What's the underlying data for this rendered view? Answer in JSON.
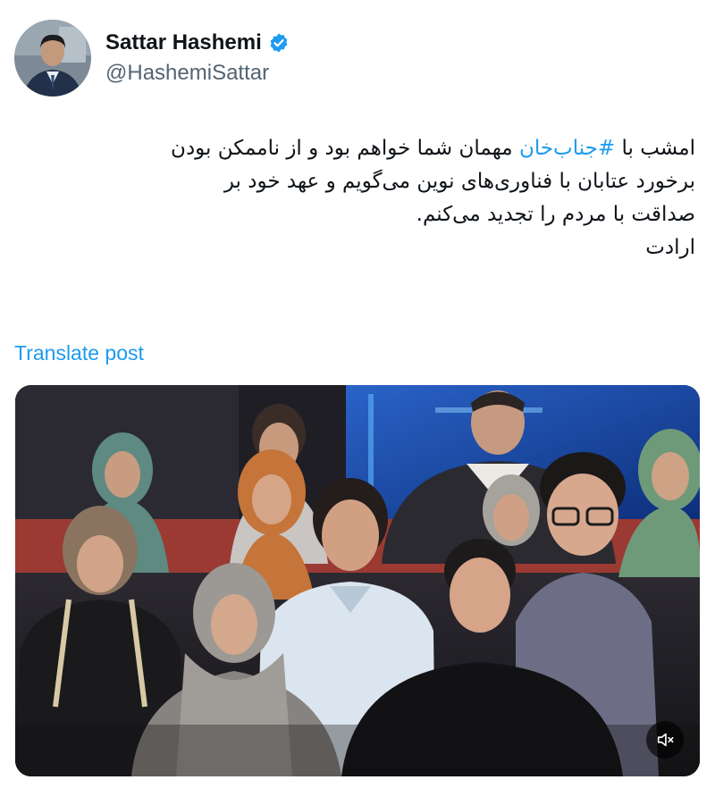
{
  "author": {
    "display_name": "Sattar Hashemi",
    "handle": "@HashemiSattar",
    "verified": true,
    "avatar_icon": "profile-photo"
  },
  "tweet": {
    "line1_prefix": "امشب با ",
    "hashtag": "#جناب‌خان",
    "line1_suffix": " مهمان شما خواهم بود و از ناممکن بودن",
    "line2": "برخورد عتابان با فناوری‌های نوین می‌گویم و عهد خود بر",
    "line3": "صداقت با مردم را تجدید می‌کنم.",
    "line4": "ارادت"
  },
  "translate_label": "Translate post",
  "media": {
    "type": "video",
    "muted": true,
    "mute_icon": "speaker-muted-icon"
  },
  "colors": {
    "accent": "#1d9bf0",
    "text_primary": "#0f1419",
    "text_secondary": "#536471"
  }
}
